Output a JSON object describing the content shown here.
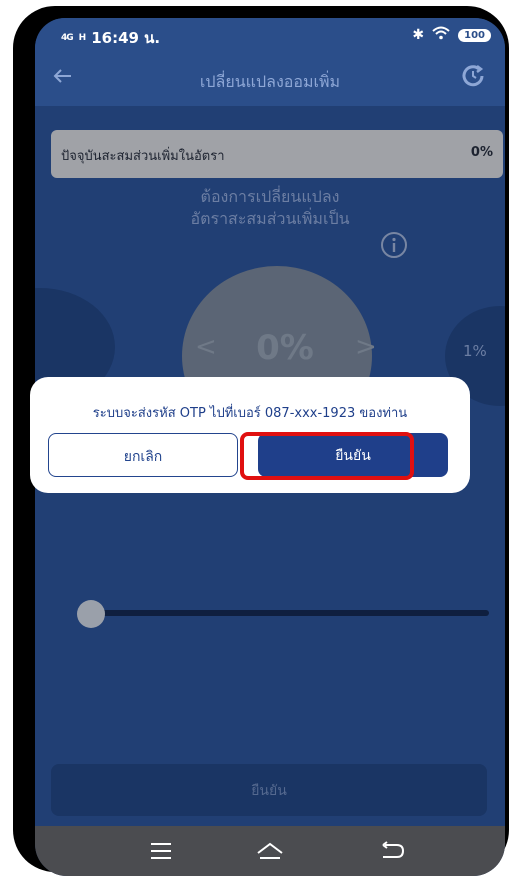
{
  "status_bar": {
    "network": "4G",
    "network2": "H",
    "time": "16:49 น.",
    "battery": "100"
  },
  "header": {
    "title": "เปลี่ยนแปลงออมเพิ่ม"
  },
  "current_rate": {
    "label": "ปัจจุบันสะสมส่วนเพิ่มในอัตรา",
    "value": "0%"
  },
  "instruction": {
    "line1": "ต้องการเปลี่ยนแปลง",
    "line2": "อัตราสะสมส่วนเพิ่มเป็น"
  },
  "selector": {
    "value": "0%",
    "prev_glyph": "<",
    "next_glyph": ">",
    "next_value": "1%"
  },
  "slider": {
    "value": 0
  },
  "bottom_button": {
    "label": "ยืนยัน"
  },
  "modal": {
    "message": "ระบบจะส่งรหัส OTP ไปที่เบอร์ 087-xxx-1923 ของท่าน",
    "cancel_label": "ยกเลิก",
    "confirm_label": "ยืนยัน"
  },
  "colors": {
    "background": "#213f74",
    "accent": "#1f3f8a",
    "highlight": "#e01010"
  },
  "icons": [
    "back-arrow-icon",
    "refresh-icon",
    "info-icon",
    "menu-icon",
    "home-icon",
    "back-nav-icon",
    "bluetooth-icon",
    "wifi-icon"
  ]
}
